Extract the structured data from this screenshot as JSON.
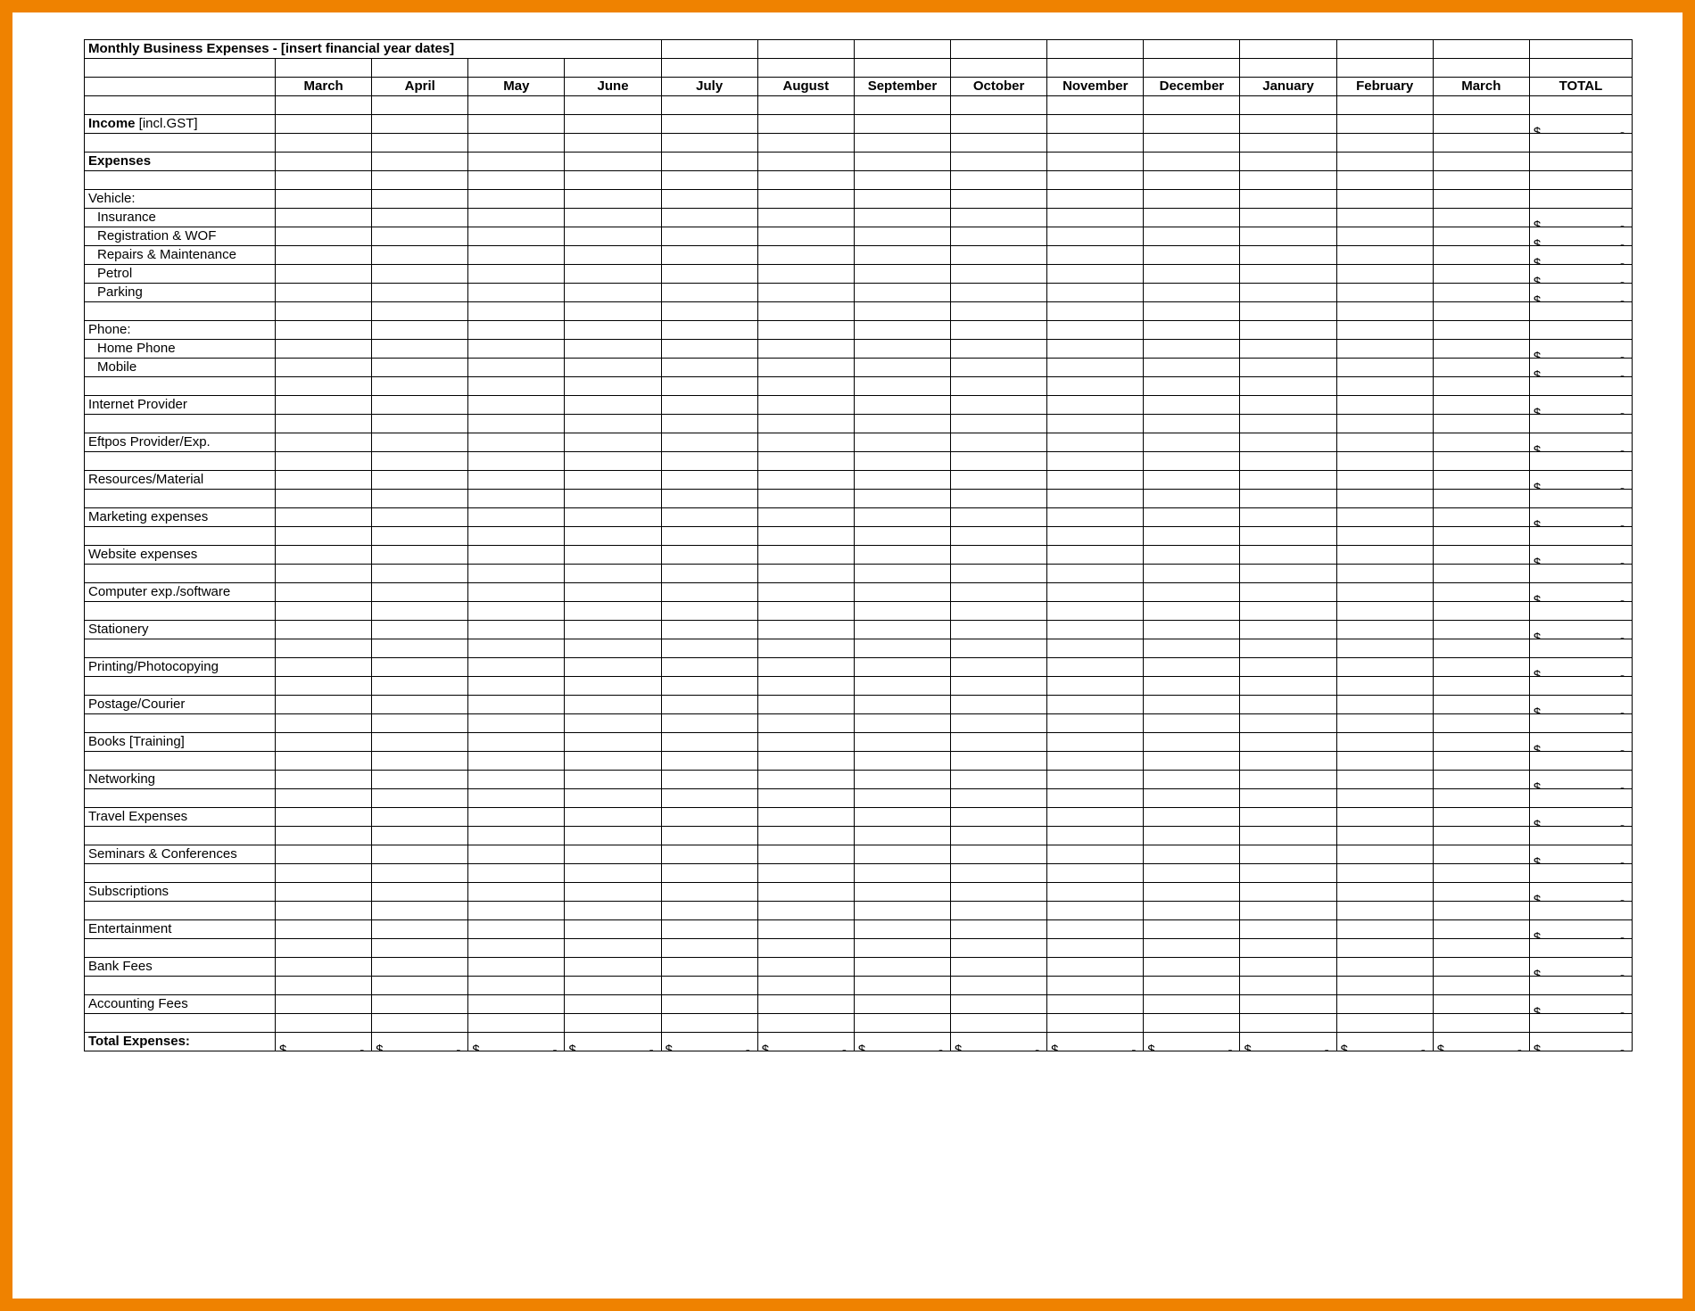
{
  "title": "Monthly Business Expenses - [insert financial year dates]",
  "months": [
    "March",
    "April",
    "May",
    "June",
    "July",
    "August",
    "September",
    "October",
    "November",
    "December",
    "January",
    "February",
    "March"
  ],
  "totalHeader": "TOTAL",
  "income": {
    "label_bold": "Income",
    "label_rest": " [incl.GST]"
  },
  "expensesHeader": "Expenses",
  "vehicle": {
    "header": "Vehicle:",
    "items": [
      "Insurance",
      "Registration & WOF",
      "Repairs & Maintenance",
      "Petrol",
      "Parking"
    ]
  },
  "phone": {
    "header": "Phone:",
    "items": [
      "Home Phone",
      "Mobile"
    ]
  },
  "lines": [
    "Internet Provider",
    "Eftpos Provider/Exp.",
    "Resources/Material",
    "Marketing expenses",
    "Website expenses",
    "Computer exp./software",
    "Stationery",
    "Printing/Photocopying",
    "Postage/Courier",
    "Books [Training]",
    "Networking",
    "Travel Expenses",
    "Seminars & Conferences",
    "Subscriptions",
    "Entertainment",
    "Bank Fees",
    "Accounting Fees"
  ],
  "totalExpenses": "Total Expenses:",
  "currency": "$",
  "dash": "-"
}
